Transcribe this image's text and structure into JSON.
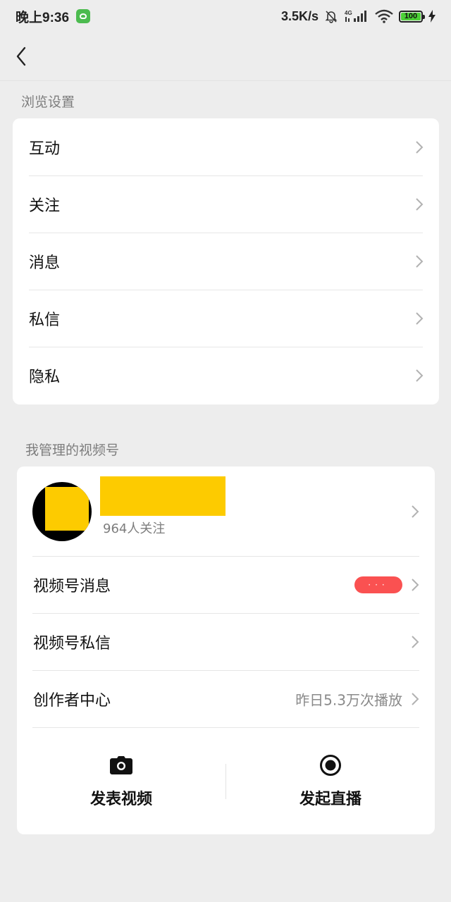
{
  "status_bar": {
    "time": "晚上9:36",
    "net_speed": "3.5K/s",
    "network_type": "4G",
    "battery": "100"
  },
  "browse_settings": {
    "title": "浏览设置",
    "items": [
      {
        "label": "互动"
      },
      {
        "label": "关注"
      },
      {
        "label": "消息"
      },
      {
        "label": "私信"
      },
      {
        "label": "隐私"
      }
    ]
  },
  "managed_channels": {
    "title": "我管理的视频号",
    "profile": {
      "followers": "964人关注"
    },
    "items": [
      {
        "label": "视频号消息",
        "badge": "···"
      },
      {
        "label": "视频号私信"
      },
      {
        "label": "创作者中心",
        "value": "昨日5.3万次播放"
      }
    ],
    "actions": [
      {
        "label": "发表视频",
        "icon": "camera-icon"
      },
      {
        "label": "发起直播",
        "icon": "live-record-icon"
      }
    ]
  },
  "colors": {
    "background": "#ededed",
    "card": "#ffffff",
    "badge": "#fa5151",
    "redaction": "#fdcb00"
  }
}
